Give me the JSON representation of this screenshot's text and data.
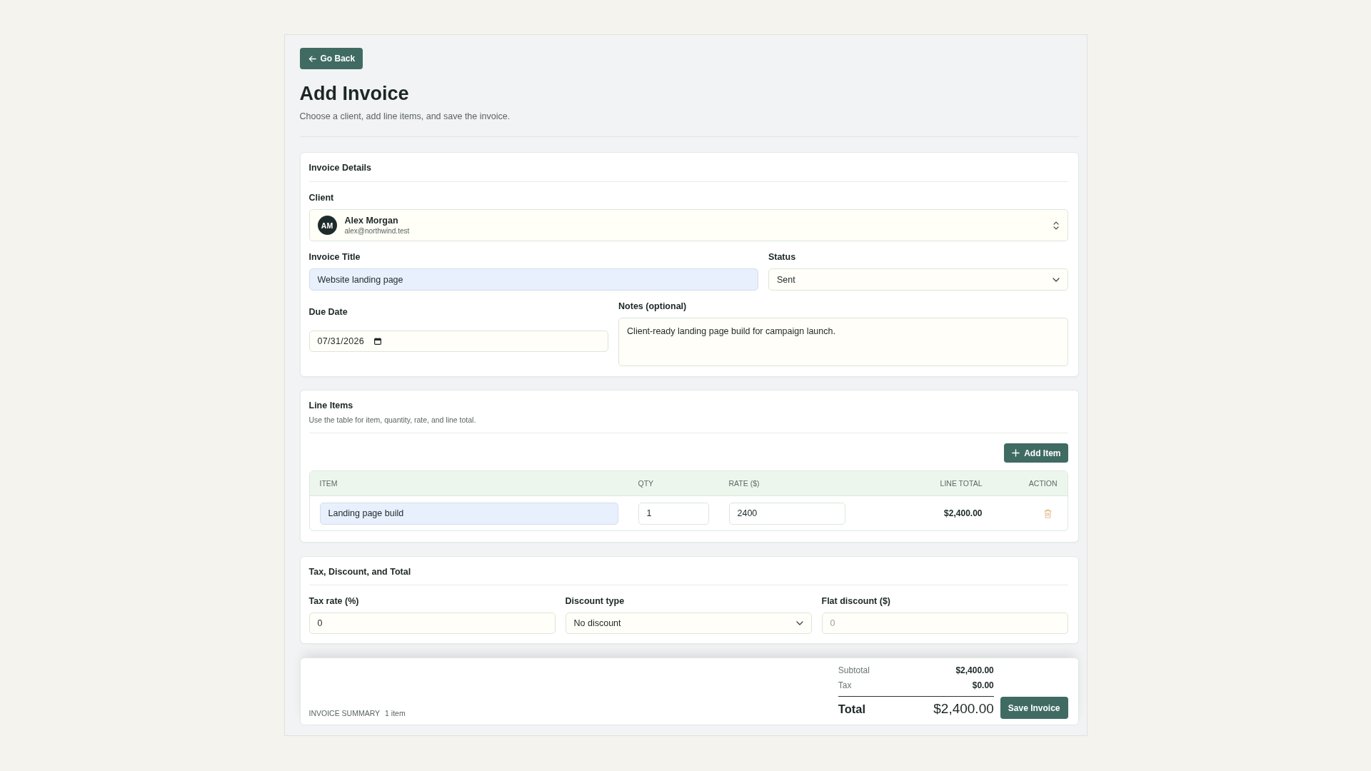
{
  "header": {
    "back_button": "Go Back",
    "title": "Add Invoice",
    "subtitle": "Choose a client, add line items, and save the invoice."
  },
  "invoice_details": {
    "heading": "Invoice Details",
    "client": {
      "label": "Client",
      "initials": "AM",
      "name": "Alex Morgan",
      "email": "alex@northwind.test"
    },
    "invoice_title": {
      "label": "Invoice Title",
      "value": "Website landing page",
      "autofilled": true
    },
    "status": {
      "label": "Status",
      "value": "Sent"
    },
    "due_date": {
      "label": "Due Date",
      "value": "07/31/2026"
    },
    "notes": {
      "label": "Notes (optional)",
      "value": "Client-ready landing page build for campaign launch."
    }
  },
  "line_items": {
    "heading": "Line Items",
    "subtitle": "Use the table for item, quantity, rate, and line total.",
    "add_button": "Add Item",
    "table": {
      "columns": [
        "ITEM",
        "QTY",
        "RATE ($)",
        "LINE TOTAL",
        "ACTION"
      ],
      "rows": [
        {
          "item": "Landing page build",
          "item_autofilled": true,
          "qty": "1",
          "rate": "2400",
          "line_total": "$2,400.00"
        }
      ]
    }
  },
  "tax_discount": {
    "heading": "Tax, Discount, and Total",
    "fields": [
      {
        "kind": "input",
        "label": "Tax rate (%)",
        "value": "0"
      },
      {
        "kind": "select",
        "label": "Discount type",
        "value": "No discount"
      },
      {
        "kind": "input",
        "label": "Flat discount ($)",
        "placeholder": "0"
      }
    ]
  },
  "summary": {
    "label": "INVOICE SUMMARY",
    "count": "1 item",
    "rows": [
      {
        "label": "Subtotal",
        "value": "$2,400.00"
      },
      {
        "label": "Tax",
        "value": "$0.00"
      }
    ],
    "total": {
      "label": "Total",
      "value": "$2,400.00"
    },
    "save_button": "Save Invoice"
  }
}
